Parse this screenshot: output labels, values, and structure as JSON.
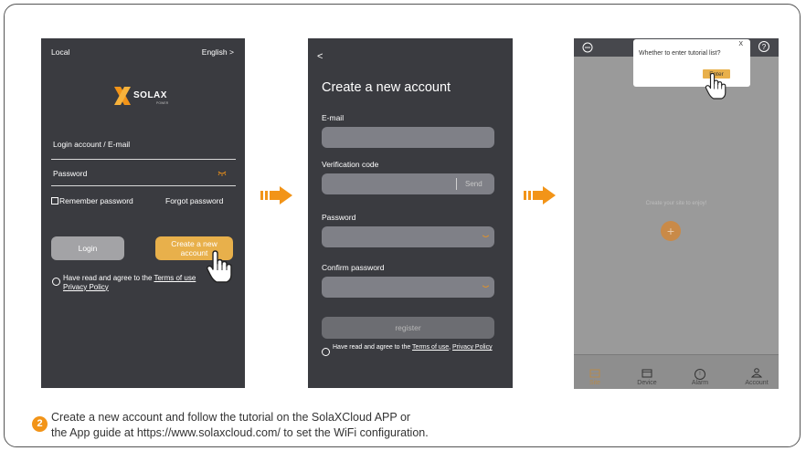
{
  "screen1": {
    "top_left": "Local",
    "language": "English >",
    "logo_text": "SOLAX",
    "logo_sub": "POWER",
    "account_label": "Login account / E-mail",
    "password_label": "Password",
    "remember_label": "Remember password",
    "forgot_label": "Forgot password",
    "login_button": "Login",
    "create_button": "Create a new account",
    "agree_prefix": "Have read and agree to the ",
    "terms_link": "Terms of use",
    "privacy_link": "Privacy Policy"
  },
  "screen2": {
    "back": "<",
    "title": "Create a new account",
    "email_label": "E-mail",
    "verification_label": "Verification code",
    "send_label": "Send",
    "password_label": "Password",
    "confirm_label": "Confirm password",
    "register_button": "register",
    "agree_prefix": "Have read and agree to the ",
    "terms_link": "Terms of use",
    "privacy_link": "Privacy Policy"
  },
  "screen3": {
    "popup_text": "Whether to enter tutorial list?",
    "popup_close": "X",
    "enter_button": "Enter",
    "center_text": "Create your site to enjoy!",
    "add_symbol": "+",
    "nav": [
      "Site",
      "Device",
      "Alarm",
      "Account"
    ],
    "help_symbol": "?",
    "alarm_symbol": "!"
  },
  "step_number": "2",
  "instruction_line1": "Create a new account and follow the tutorial on the SolaXCloud APP or",
  "instruction_line2": "the App guide at https://www.solaxcloud.com/ to set the WiFi configuration.",
  "colors": {
    "phone_dark": "#3a3b40",
    "accent_orange": "#f29418",
    "gold_button": "#e8b04b",
    "gray_field": "#7f8087"
  }
}
